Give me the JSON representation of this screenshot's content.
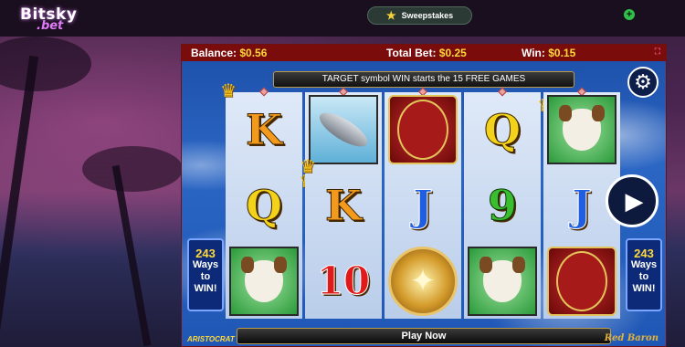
{
  "topbar": {
    "logo_main": "Bitsky",
    "logo_sub": ".bet",
    "sweepstakes_label": "Sweepstakes",
    "star_icon": "star-icon",
    "plus_icon": "plus-icon"
  },
  "game": {
    "balance_label": "Balance:",
    "balance_value": "$0.56",
    "total_bet_label": "Total Bet:",
    "total_bet_value": "$0.25",
    "win_label": "Win:",
    "win_value": "$0.15",
    "target_banner": "TARGET symbol WIN starts the 15 FREE GAMES",
    "ways_number": "243",
    "ways_line1": "Ways",
    "ways_line2": "to",
    "ways_line3": "WIN!",
    "play_now": "Play Now",
    "brand_left": "ARISTOCRAT",
    "brand_right": "Red Baron",
    "reels": [
      [
        "K",
        "Q",
        "dog"
      ],
      [
        "zeppelin",
        "K",
        "10"
      ],
      [
        "baron",
        "J",
        "medal"
      ],
      [
        "Q",
        "9",
        "dog"
      ],
      [
        "dog",
        "J",
        "baron"
      ]
    ]
  },
  "colors": {
    "stats_bar": "#7a0c0c",
    "accent_yellow": "#ffd83a",
    "sweep_green": "#2fbf4a"
  }
}
